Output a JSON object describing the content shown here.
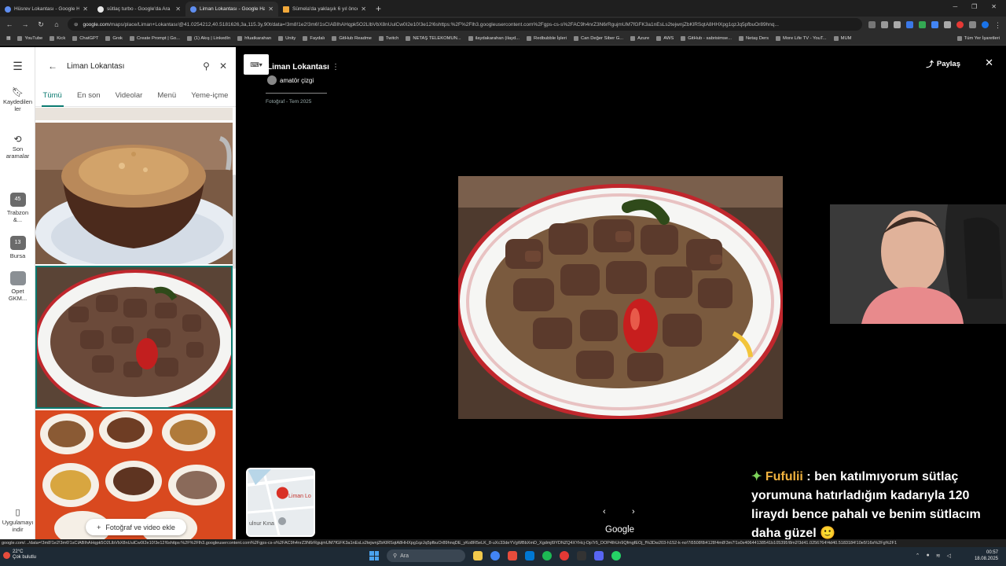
{
  "browser": {
    "tabs": [
      {
        "title": "Hüsrev Lokantası - Google Har",
        "active": false
      },
      {
        "title": "sütlaç turbo - Google'da Ara",
        "active": false
      },
      {
        "title": "Liman Lokantası - Google Har",
        "active": true
      },
      {
        "title": "Sümela'da yaklaşık 6 yıl önce b",
        "active": false
      }
    ],
    "url_domain": "google.com",
    "url_rest": "/maps/place/Liman+Lokantası/@41.0254212,40.5181626,3a,115.3y,90t/data=!3m8!1e2!3m6!1sCIABIhAHqpk5O2LlbVbX8nUulCw0I2e10!3e12!6shttps:%2F%2Flh3.googleusercontent.com%2Fgps-cs-s%2FAC9h4nrZ3N6rRgujmUM7fGFK3a1nEsLs2tejwnjZbKlRSqtA8HHXpg1qzJq5pfbuOr89hnq...",
    "bookmarks": [
      "YouTube",
      "Kick",
      "ChatGPT",
      "Grok",
      "Create Prompt | Go...",
      "(1) Akış | LinkedIn",
      "hfuatkarahan",
      "Unity",
      "Faydalı",
      "GitHub Readme",
      "Twitch",
      "NETAŞ TELEKOMUN...",
      "ilaydakarahan (ilayd...",
      "Redbubble İşleri",
      "Can Değer Siber G...",
      "Azure",
      "AWS",
      "GitHub - sabrisimse...",
      "Netaş Ders",
      "More Life TV - YouT...",
      "MUM"
    ],
    "bookmarks_right": "Tüm Yer İşaretleri"
  },
  "rail": {
    "items": [
      {
        "label": "Kaydedilenler"
      },
      {
        "label": "Son aramalar"
      },
      {
        "label": "Trabzon &...",
        "badge": "45"
      },
      {
        "label": "Bursa",
        "badge": "13"
      },
      {
        "label": "Opet GKM..."
      },
      {
        "label": "Uygulamayı indir"
      }
    ]
  },
  "panel": {
    "search_value": "Liman Lokantası",
    "tabs": [
      "Tümü",
      "En son",
      "Videolar",
      "Menü",
      "Yeme-içme"
    ],
    "add_photo_label": "Fotoğraf ve video ekle"
  },
  "viewer": {
    "place_name": "Liman Lokantası",
    "author": "amatör çizgi",
    "date": "Fotoğraf - Tem 2025",
    "share_label": "Paylaş",
    "minimap_label": "Liman Lo",
    "minimap_label2": "ulnur Kına",
    "google_label": "Google"
  },
  "chat": {
    "user": "Fufulii",
    "message": ": ben katılmıyorum sütlaç yorumuna hatırladığım kadarıyla 120 liraydı bence pahalı ve benim sütlacım daha güzel 🙂"
  },
  "statusbar": {
    "url": "google.com/.../data=!3m8!1e2!3m6!1sCIABIhAHqpk5O2LlbVbX8nUulCw0I2e10!3e12!6shttps:%2F%2Flh3.googleusercontent.com%2Fgps-cs-s%2FAC9h4nrZ3N6rRgujmUM7fGFK3a1nEsLs2tejwnjZbKlRSqtA8HHXpg1qzJq5pfbuOr89hnqDE_yKo8R5eLK_8-uXc33deYVgWBbXmD_XgdmjI9YDNZQ4XYHcj-Op7r5_DOP4lhUn9QfmgfEOj_f%3Dw203-h152-k-no!7i5508!8i4128!4m8!3m7!1s0x40644138541b105395!8m2!3d41.0256764!4d40.5183184!10e5!16s%2Fg%2F1"
  },
  "taskbar": {
    "temp": "22°C",
    "weather": "Çok bulutlu",
    "search_label": "Ara",
    "time": "00:57",
    "date": "18.08.2025"
  },
  "colors": {
    "accent_teal": "#0b7a70",
    "chat_name": "#f0b23f"
  }
}
